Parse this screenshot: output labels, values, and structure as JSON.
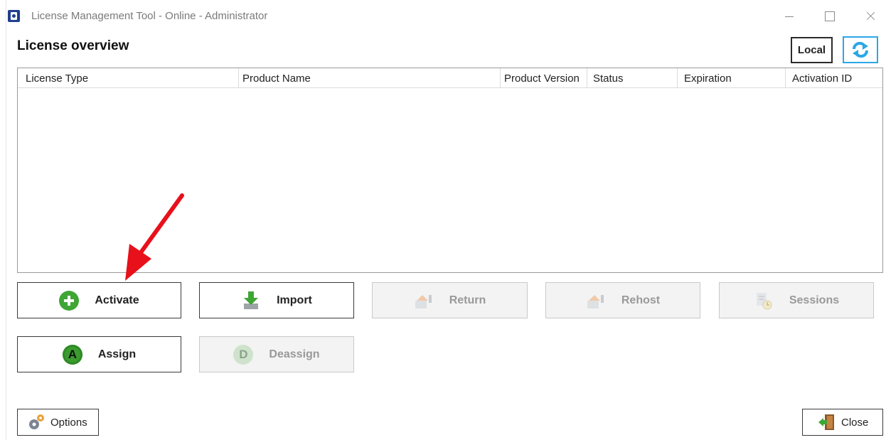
{
  "window": {
    "title": "License Management Tool - Online - Administrator"
  },
  "header": {
    "section_title": "License overview",
    "local_label": "Local"
  },
  "table": {
    "columns": [
      "License Type",
      "Product Name",
      "Product Version",
      "Status",
      "Expiration",
      "Activation ID"
    ],
    "rows": []
  },
  "actions": {
    "activate": "Activate",
    "import": "Import",
    "return": "Return",
    "rehost": "Rehost",
    "sessions": "Sessions",
    "assign": "Assign",
    "deassign": "Deassign"
  },
  "footer": {
    "options": "Options",
    "close": "Close"
  },
  "colors": {
    "accent_green": "#3fa535",
    "sync_blue": "#2aa7e6",
    "annotation_red": "#e8101a",
    "app_icon_blue": "#1f3f8f"
  }
}
